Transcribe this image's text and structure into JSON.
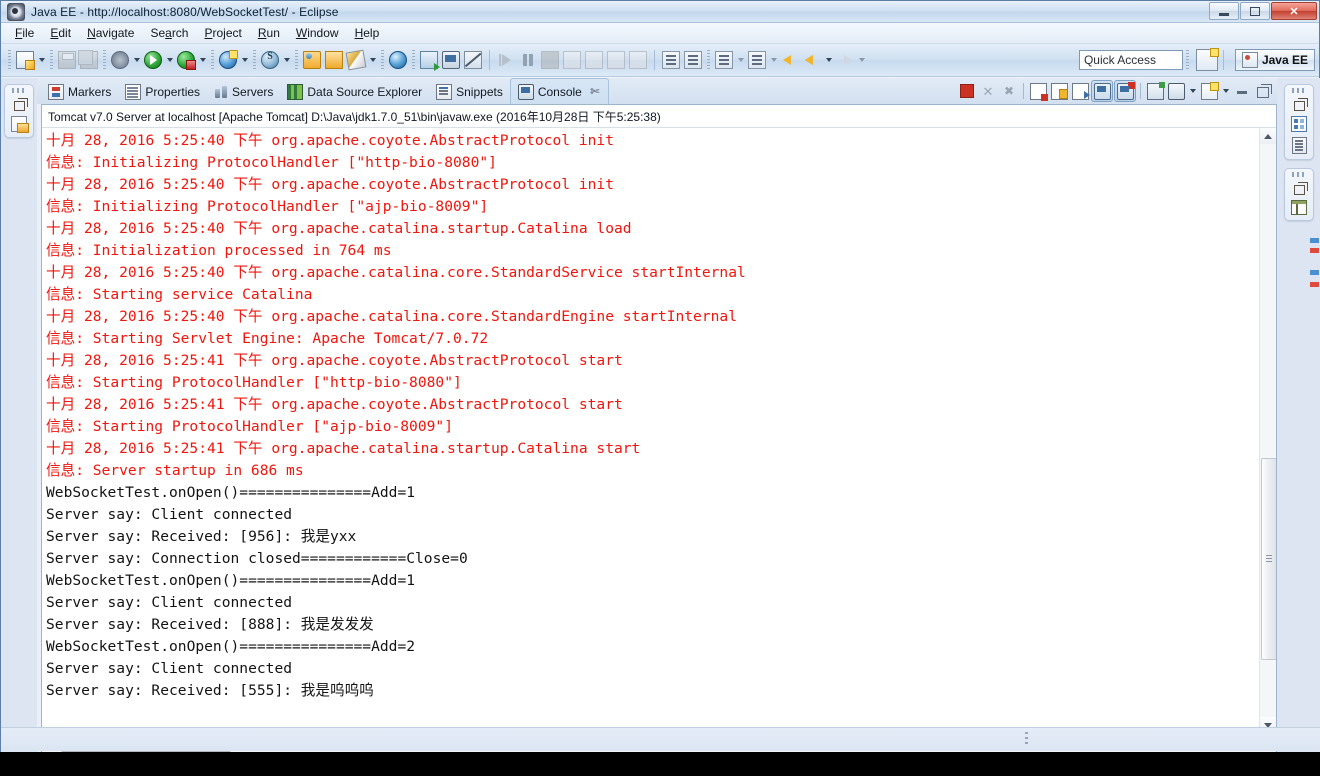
{
  "window": {
    "title": "Java EE - http://localhost:8080/WebSocketTest/ - Eclipse",
    "app_icon": "eclipse-icon",
    "buttons": {
      "minimize": "minimize",
      "maximize": "maximize",
      "close": "✕"
    }
  },
  "menubar": {
    "items": [
      {
        "label": "File",
        "mnemonic": "F"
      },
      {
        "label": "Edit",
        "mnemonic": "E"
      },
      {
        "label": "Navigate",
        "mnemonic": "N"
      },
      {
        "label": "Search",
        "mnemonic": "a"
      },
      {
        "label": "Project",
        "mnemonic": "P"
      },
      {
        "label": "Run",
        "mnemonic": "R"
      },
      {
        "label": "Window",
        "mnemonic": "W"
      },
      {
        "label": "Help",
        "mnemonic": "H"
      }
    ]
  },
  "toolbar": {
    "quick_access_placeholder": "Quick Access",
    "perspective_label": "Java EE",
    "buttons": [
      "new-wizard-icon",
      "save-icon",
      "save-all-icon",
      "debug-icon",
      "run-icon",
      "run-on-server-icon",
      "new-web-project-icon",
      "new-session-bean-icon",
      "open-type-icon",
      "open-resource-icon",
      "external-tools-icon",
      "open-web-browser-icon",
      "search-icon",
      "console-icon",
      "no-marker-icon",
      "resume-icon",
      "suspend-icon",
      "terminate-icon",
      "step-into-icon",
      "step-over-icon",
      "step-return-icon",
      "next-annotation-icon",
      "previous-annotation-icon",
      "last-edit-location-icon",
      "back-icon",
      "forward-icon"
    ]
  },
  "view_tabs": [
    {
      "label": "Markers",
      "icon": "markers-icon",
      "active": false
    },
    {
      "label": "Properties",
      "icon": "properties-icon",
      "active": false
    },
    {
      "label": "Servers",
      "icon": "servers-icon",
      "active": false
    },
    {
      "label": "Data Source Explorer",
      "icon": "data-source-icon",
      "active": false
    },
    {
      "label": "Snippets",
      "icon": "snippets-icon",
      "active": false
    },
    {
      "label": "Console",
      "icon": "console-icon",
      "active": true,
      "closable": true
    }
  ],
  "view_toolbar": [
    "terminate-icon",
    "remove-launch-icon",
    "remove-all-terminated-icon",
    "clear-console-icon",
    "scroll-lock-icon",
    "show-console-on-output-icon",
    "pin-console-icon",
    "display-selected-console-icon",
    "open-console-icon",
    "minimize-icon",
    "maximize-icon"
  ],
  "console": {
    "header": "Tomcat v7.0 Server at localhost [Apache Tomcat] D:\\Java\\jdk1.7.0_51\\bin\\javaw.exe (2016年10月28日 下午5:25:38)",
    "lines": [
      {
        "text": "十月 28, 2016 5:25:40 下午 org.apache.coyote.AbstractProtocol init",
        "color": "red"
      },
      {
        "text": "信息: Initializing ProtocolHandler [\"http-bio-8080\"]",
        "color": "red"
      },
      {
        "text": "十月 28, 2016 5:25:40 下午 org.apache.coyote.AbstractProtocol init",
        "color": "red"
      },
      {
        "text": "信息: Initializing ProtocolHandler [\"ajp-bio-8009\"]",
        "color": "red"
      },
      {
        "text": "十月 28, 2016 5:25:40 下午 org.apache.catalina.startup.Catalina load",
        "color": "red"
      },
      {
        "text": "信息: Initialization processed in 764 ms",
        "color": "red"
      },
      {
        "text": "十月 28, 2016 5:25:40 下午 org.apache.catalina.core.StandardService startInternal",
        "color": "red"
      },
      {
        "text": "信息: Starting service Catalina",
        "color": "red"
      },
      {
        "text": "十月 28, 2016 5:25:40 下午 org.apache.catalina.core.StandardEngine startInternal",
        "color": "red"
      },
      {
        "text": "信息: Starting Servlet Engine: Apache Tomcat/7.0.72",
        "color": "red"
      },
      {
        "text": "十月 28, 2016 5:25:41 下午 org.apache.coyote.AbstractProtocol start",
        "color": "red"
      },
      {
        "text": "信息: Starting ProtocolHandler [\"http-bio-8080\"]",
        "color": "red"
      },
      {
        "text": "十月 28, 2016 5:25:41 下午 org.apache.coyote.AbstractProtocol start",
        "color": "red"
      },
      {
        "text": "信息: Starting ProtocolHandler [\"ajp-bio-8009\"]",
        "color": "red"
      },
      {
        "text": "十月 28, 2016 5:25:41 下午 org.apache.catalina.startup.Catalina start",
        "color": "red"
      },
      {
        "text": "信息: Server startup in 686 ms",
        "color": "red"
      },
      {
        "text": "WebSocketTest.onOpen()===============Add=1",
        "color": "black"
      },
      {
        "text": "Server say: Client connected",
        "color": "black"
      },
      {
        "text": "Server say: Received: [956]: 我是yxx",
        "color": "black"
      },
      {
        "text": "Server say: Connection closed============Close=0",
        "color": "black"
      },
      {
        "text": "WebSocketTest.onOpen()===============Add=1",
        "color": "black"
      },
      {
        "text": "Server say: Client connected",
        "color": "black"
      },
      {
        "text": "Server say: Received: [888]: 我是发发发",
        "color": "black"
      },
      {
        "text": "WebSocketTest.onOpen()===============Add=2",
        "color": "black"
      },
      {
        "text": "Server say: Client connected",
        "color": "black"
      },
      {
        "text": "Server say: Received: [555]: 我是呜呜呜",
        "color": "black"
      }
    ]
  },
  "left_rail": {
    "groups": [
      {
        "restore_label": "restore-icon",
        "items": [
          "project-explorer-icon"
        ]
      }
    ]
  },
  "right_rail": {
    "groups": [
      {
        "restore_label": "restore-icon",
        "items": [
          "outline-icon",
          "task-list-icon"
        ]
      },
      {
        "restore_label": "restore-icon",
        "items": [
          "servers-view-icon"
        ]
      }
    ]
  },
  "statusbar": {
    "text": ""
  },
  "colors": {
    "console_red": "#f0160d",
    "console_black": "#131313",
    "tab_active_bg": "#cddff2",
    "chrome_blue": "#dfe7f3",
    "accent_border": "#9db4cb"
  }
}
